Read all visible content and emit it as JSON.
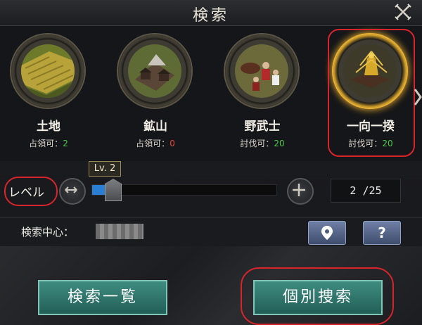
{
  "header": {
    "title": "検索"
  },
  "categories": [
    {
      "id": "land",
      "label": "土地",
      "status_label": "占領可：",
      "status_value": "2",
      "status_color": "green",
      "icon": "rice-field-icon",
      "selected": false
    },
    {
      "id": "mine",
      "label": "鉱山",
      "status_label": "占領可：",
      "status_value": "0",
      "status_color": "red",
      "icon": "mine-icon",
      "selected": false
    },
    {
      "id": "bandits",
      "label": "野武士",
      "status_label": "討伐可：",
      "status_value": "20",
      "status_color": "green",
      "icon": "bandits-icon",
      "selected": false
    },
    {
      "id": "ikko",
      "label": "一向一揆",
      "status_label": "討伐可：",
      "status_value": "20",
      "status_color": "green",
      "icon": "ikko-uprising-icon",
      "selected": true
    }
  ],
  "level": {
    "label": "レベル",
    "tag": "Lv. 2",
    "count": "2 /25",
    "current": 2,
    "max": 25
  },
  "search_center": {
    "label": "検索中心："
  },
  "actions": {
    "list_label": "検索一覧",
    "individual_label": "個別捜索"
  },
  "colors": {
    "accent_teal": "#2f7f74",
    "selected_gold": "#e0a52a",
    "highlight_red": "#d8252b",
    "status_green": "#4cc84a",
    "status_red": "#e24a3a"
  }
}
